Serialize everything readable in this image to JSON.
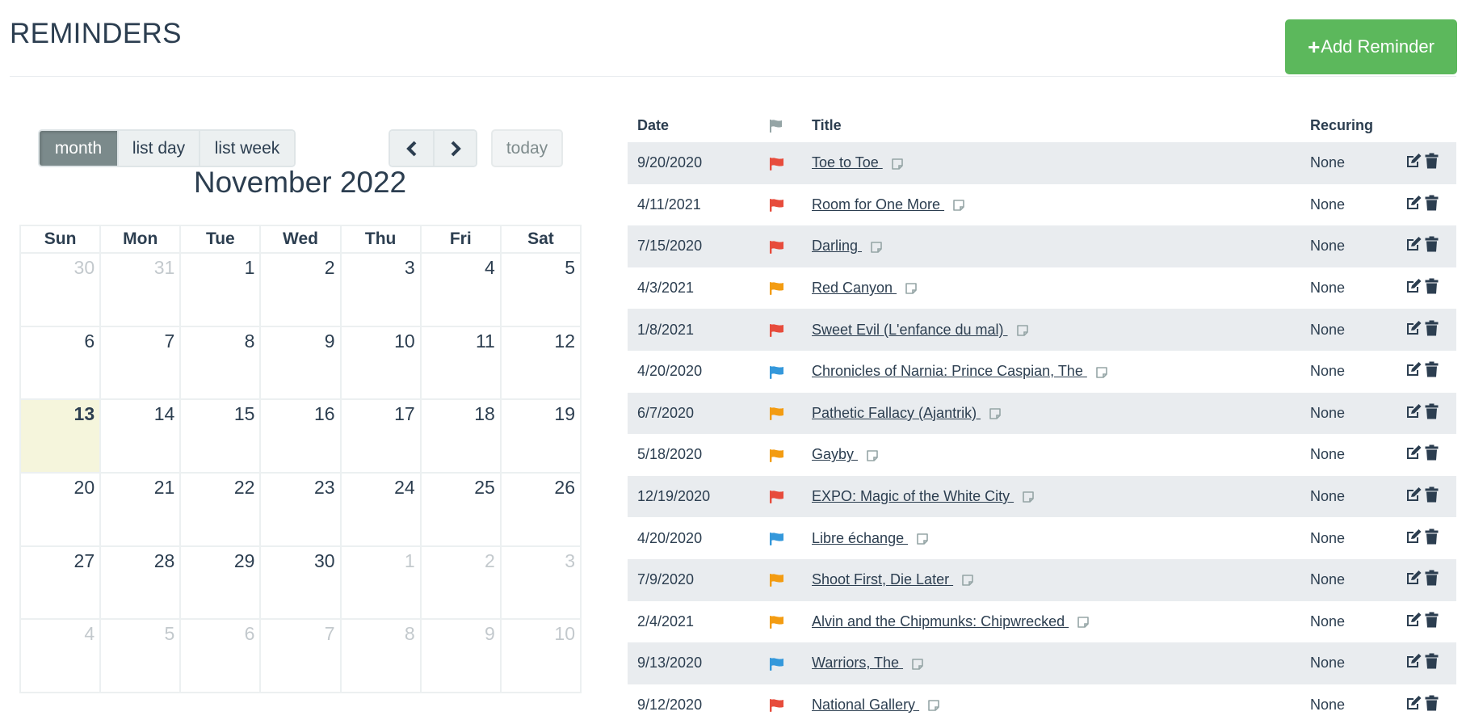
{
  "header": {
    "title": "REMINDERS",
    "add_button": {
      "icon": "plus-icon",
      "label": "Add Reminder",
      "color": "#5cb85c"
    }
  },
  "calendar": {
    "views": [
      {
        "label": "month",
        "active": true
      },
      {
        "label": "list day",
        "active": false
      },
      {
        "label": "list week",
        "active": false
      }
    ],
    "prev_icon": "chevron-left-icon",
    "next_icon": "chevron-right-icon",
    "today_label": "today",
    "title": "November 2022",
    "weekdays": [
      "Sun",
      "Mon",
      "Tue",
      "Wed",
      "Thu",
      "Fri",
      "Sat"
    ],
    "weeks": [
      [
        {
          "d": "30",
          "other": true
        },
        {
          "d": "31",
          "other": true
        },
        {
          "d": "1"
        },
        {
          "d": "2"
        },
        {
          "d": "3"
        },
        {
          "d": "4"
        },
        {
          "d": "5"
        }
      ],
      [
        {
          "d": "6"
        },
        {
          "d": "7"
        },
        {
          "d": "8"
        },
        {
          "d": "9"
        },
        {
          "d": "10"
        },
        {
          "d": "11"
        },
        {
          "d": "12"
        }
      ],
      [
        {
          "d": "13",
          "today": true
        },
        {
          "d": "14"
        },
        {
          "d": "15"
        },
        {
          "d": "16"
        },
        {
          "d": "17"
        },
        {
          "d": "18"
        },
        {
          "d": "19"
        }
      ],
      [
        {
          "d": "20"
        },
        {
          "d": "21"
        },
        {
          "d": "22"
        },
        {
          "d": "23"
        },
        {
          "d": "24"
        },
        {
          "d": "25"
        },
        {
          "d": "26"
        }
      ],
      [
        {
          "d": "27"
        },
        {
          "d": "28"
        },
        {
          "d": "29"
        },
        {
          "d": "30"
        },
        {
          "d": "1",
          "other": true
        },
        {
          "d": "2",
          "other": true
        },
        {
          "d": "3",
          "other": true
        }
      ],
      [
        {
          "d": "4",
          "other": true
        },
        {
          "d": "5",
          "other": true
        },
        {
          "d": "6",
          "other": true
        },
        {
          "d": "7",
          "other": true
        },
        {
          "d": "8",
          "other": true
        },
        {
          "d": "9",
          "other": true
        },
        {
          "d": "10",
          "other": true
        }
      ]
    ],
    "today_color": "#f5f5dc"
  },
  "reminders": {
    "columns": {
      "date": "Date",
      "flag_icon": "flag-icon",
      "title": "Title",
      "recurring": "Recuring"
    },
    "flag_colors": {
      "high": "#e74c3c",
      "medium": "#f39c12",
      "low": "#3498db",
      "header": "#95a5a6"
    },
    "rows": [
      {
        "date": "9/20/2020",
        "priority": "high",
        "title": "Toe to Toe",
        "recurring": "None"
      },
      {
        "date": "4/11/2021",
        "priority": "high",
        "title": "Room for One More",
        "recurring": "None"
      },
      {
        "date": "7/15/2020",
        "priority": "high",
        "title": "Darling",
        "recurring": "None"
      },
      {
        "date": "4/3/2021",
        "priority": "medium",
        "title": "Red Canyon",
        "recurring": "None"
      },
      {
        "date": "1/8/2021",
        "priority": "high",
        "title": "Sweet Evil (L'enfance du mal)",
        "recurring": "None"
      },
      {
        "date": "4/20/2020",
        "priority": "low",
        "title": "Chronicles of Narnia: Prince Caspian, The",
        "recurring": "None"
      },
      {
        "date": "6/7/2020",
        "priority": "medium",
        "title": "Pathetic Fallacy (Ajantrik)",
        "recurring": "None"
      },
      {
        "date": "5/18/2020",
        "priority": "medium",
        "title": "Gayby",
        "recurring": "None"
      },
      {
        "date": "12/19/2020",
        "priority": "high",
        "title": "EXPO: Magic of the White City",
        "recurring": "None"
      },
      {
        "date": "4/20/2020",
        "priority": "low",
        "title": "Libre échange",
        "recurring": "None"
      },
      {
        "date": "7/9/2020",
        "priority": "medium",
        "title": "Shoot First, Die Later",
        "recurring": "None"
      },
      {
        "date": "2/4/2021",
        "priority": "medium",
        "title": "Alvin and the Chipmunks: Chipwrecked",
        "recurring": "None"
      },
      {
        "date": "9/13/2020",
        "priority": "low",
        "title": "Warriors, The",
        "recurring": "None"
      },
      {
        "date": "9/12/2020",
        "priority": "high",
        "title": "National Gallery",
        "recurring": "None"
      }
    ],
    "row_actions": [
      "edit-icon",
      "trash-icon"
    ]
  }
}
